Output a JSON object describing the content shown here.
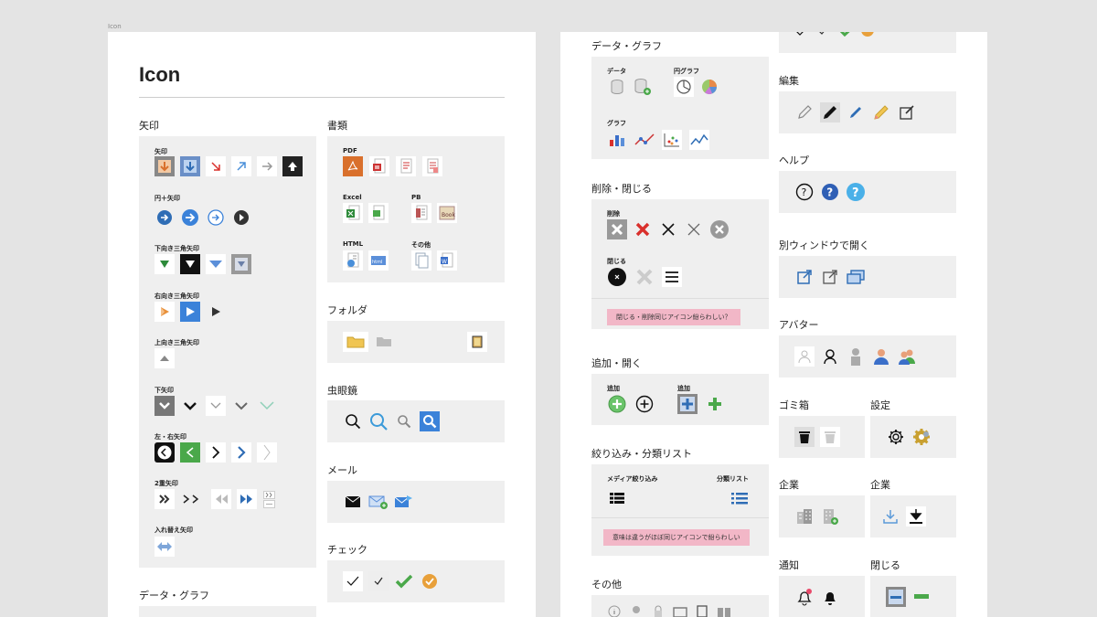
{
  "frame_label": "Icon",
  "left_page": {
    "title": "Icon",
    "sections": {
      "arrows": {
        "title": "矢印",
        "subs": [
          "矢印",
          "円＋矢印",
          "下向き三角矢印",
          "右向き三角矢印",
          "上向き三角矢印",
          "下矢印",
          "左・右矢印",
          "2重矢印",
          "入れ替え矢印"
        ]
      },
      "data_graph": {
        "title": "データ・グラフ"
      },
      "documents": {
        "title": "書類",
        "subs": [
          "PDF",
          "Excel",
          "PB",
          "HTML",
          "その他"
        ]
      },
      "folder": {
        "title": "フォルダ"
      },
      "magnifier": {
        "title": "虫眼鏡"
      },
      "mail": {
        "title": "メール"
      },
      "check": {
        "title": "チェック"
      }
    }
  },
  "right_page": {
    "data_graph": {
      "title": "データ・グラフ",
      "subs": [
        "データ",
        "円グラフ",
        "グラフ"
      ]
    },
    "delete_close": {
      "title": "削除・閉じる",
      "subs": [
        "削除",
        "閉じる"
      ],
      "note": "閉じる・削除同じアイコン紛らわしい？"
    },
    "add_open": {
      "title": "追加・開く",
      "subs": [
        "追加",
        "追加"
      ]
    },
    "filter": {
      "title": "絞り込み・分類リスト",
      "subs": [
        "メディア絞り込み",
        "分類リスト"
      ],
      "note": "意味は違うがほぼ同じアイコンで紛らわしい"
    },
    "other": {
      "title": "その他"
    },
    "edit": {
      "title": "編集"
    },
    "help": {
      "title": "ヘルプ"
    },
    "new_window": {
      "title": "別ウィンドウで開く"
    },
    "avatar": {
      "title": "アバター"
    },
    "trash": {
      "title": "ゴミ箱"
    },
    "settings": {
      "title": "設定"
    },
    "company1": {
      "title": "企業"
    },
    "company2": {
      "title": "企業"
    },
    "notify": {
      "title": "通知"
    },
    "close": {
      "title": "閉じる"
    }
  },
  "colors": {
    "blue": "#2f6db5",
    "green": "#3a9a3a",
    "orange": "#e8903a",
    "red": "#d9302c",
    "pink_note": "#f2b7c7",
    "panel": "#efefef"
  }
}
